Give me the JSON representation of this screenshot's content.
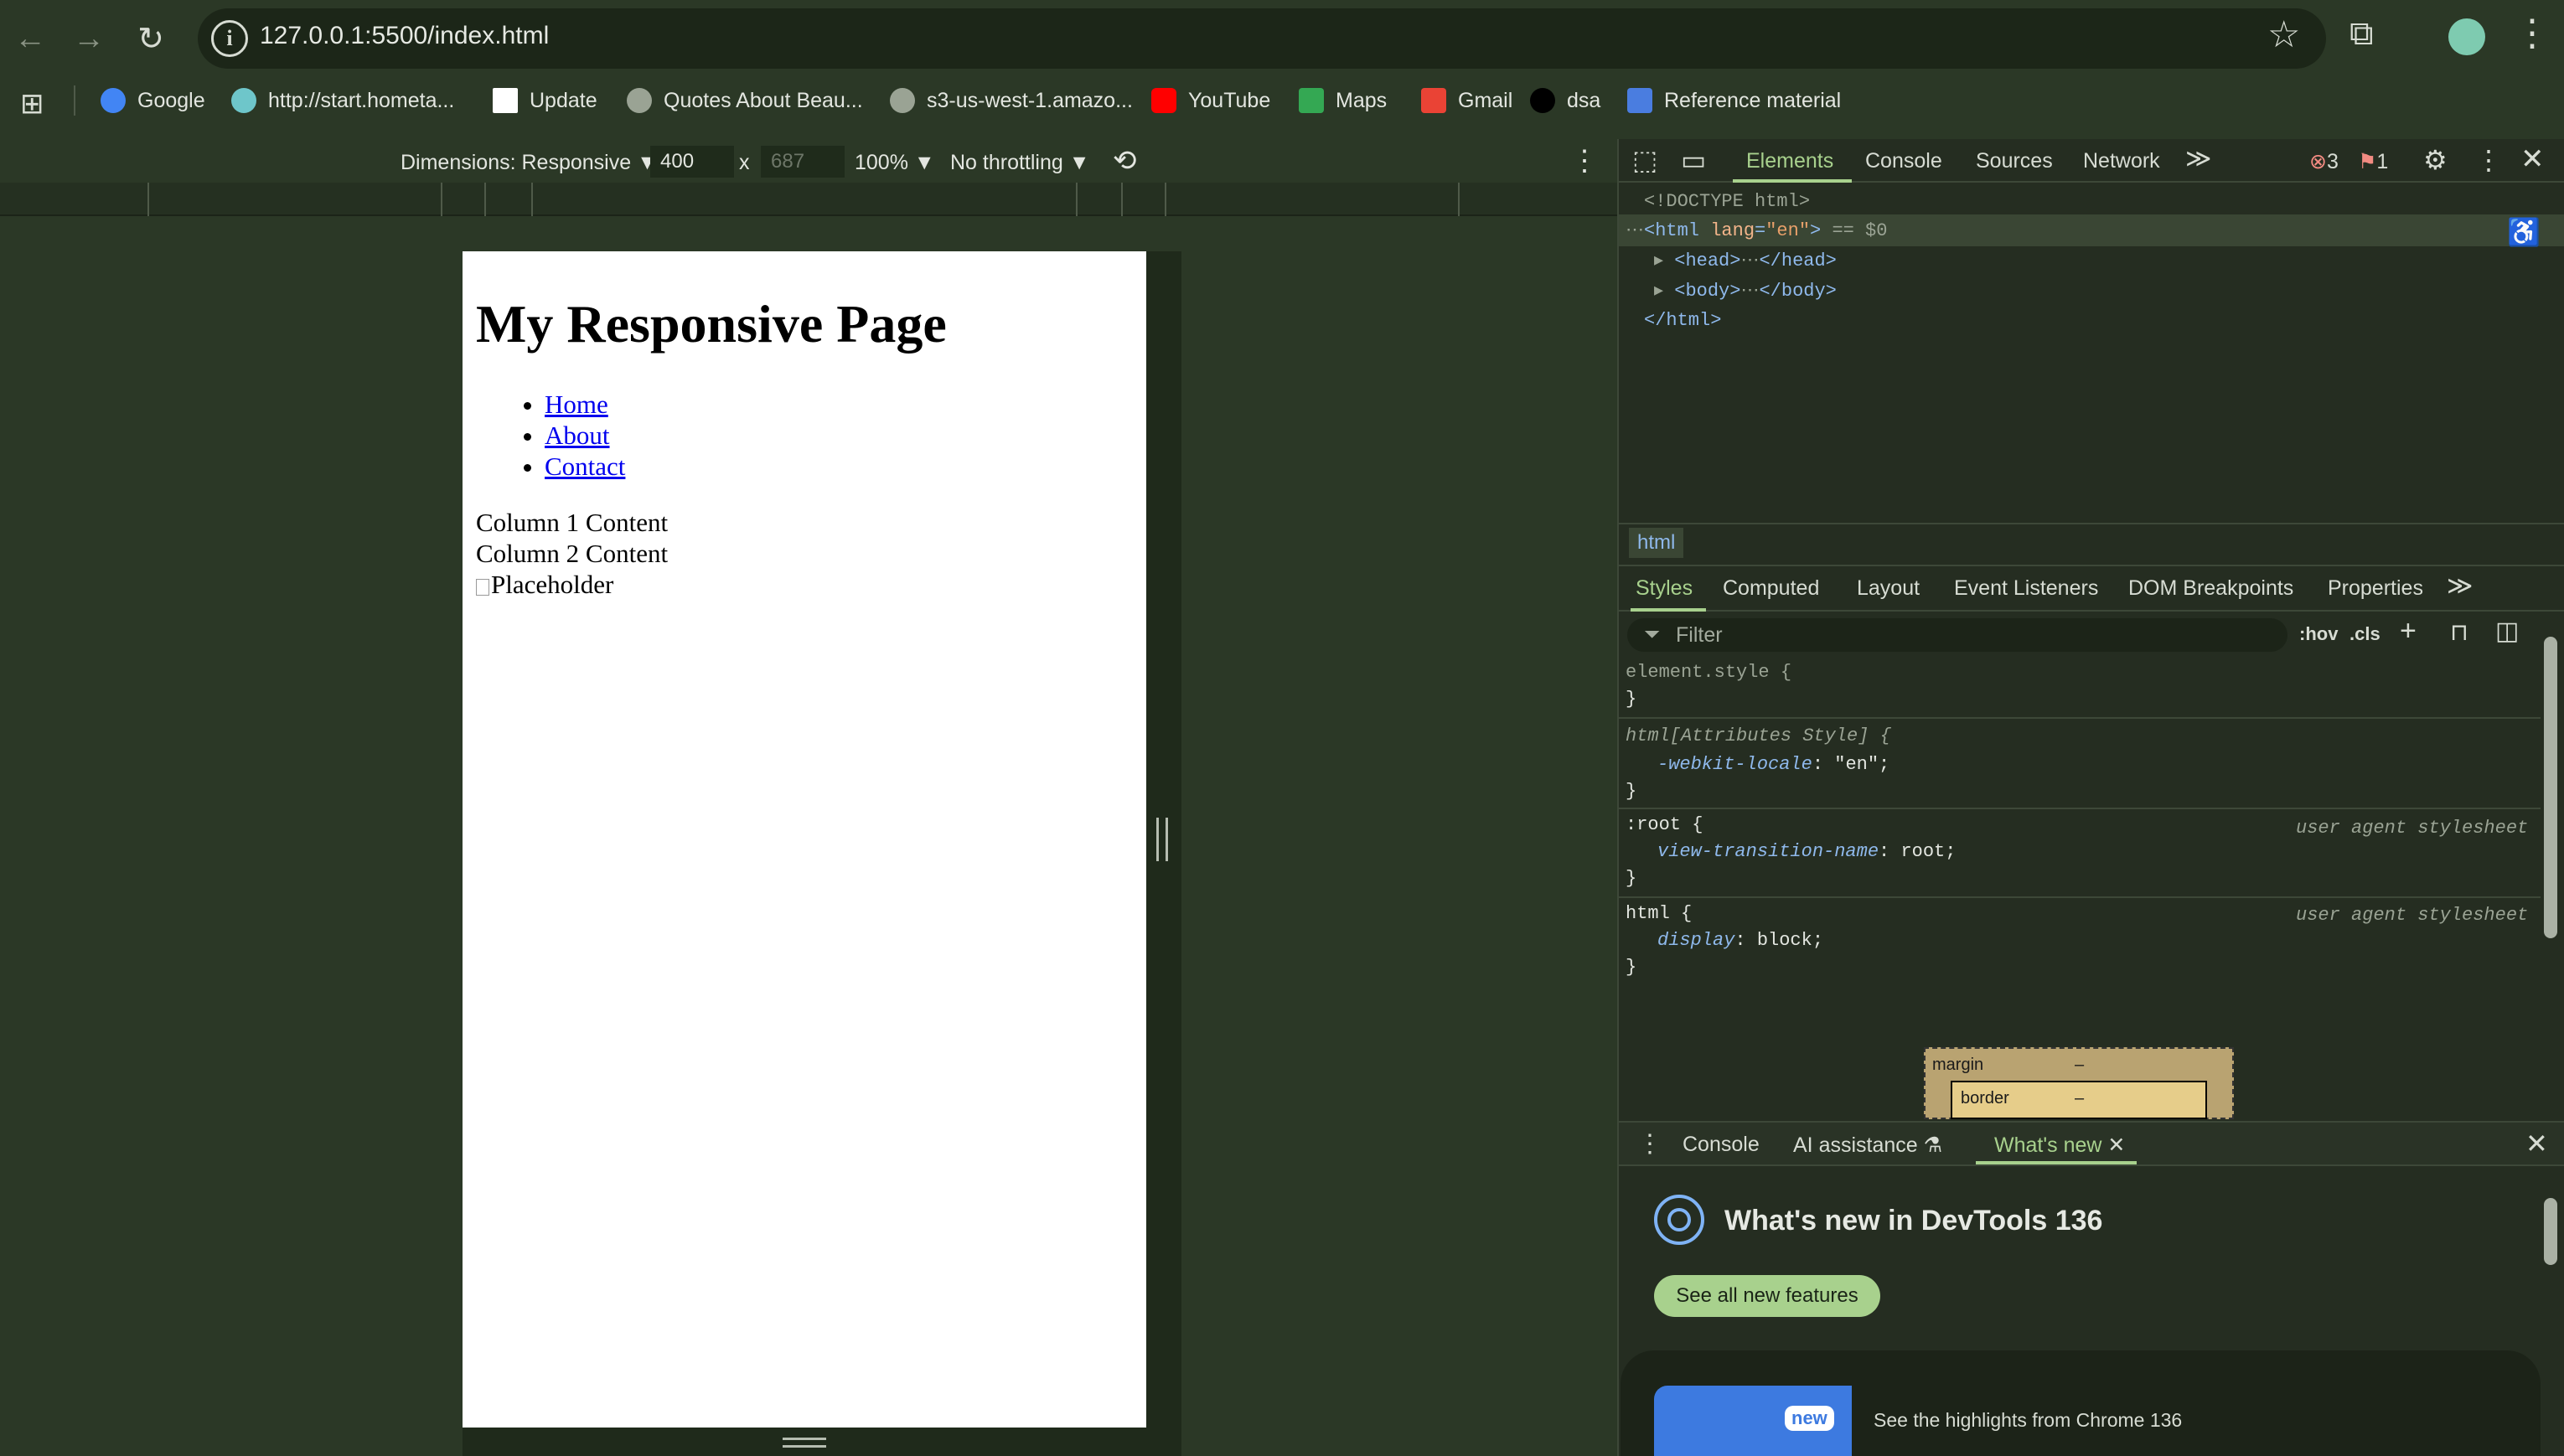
{
  "browser": {
    "url": "127.0.0.1:5500/index.html",
    "bookmarks": [
      "Google",
      "http://start.hometa...",
      "Update",
      "Quotes About Beau...",
      "s3-us-west-1.amazo...",
      "YouTube",
      "Maps",
      "Gmail",
      "dsa",
      "Reference material"
    ]
  },
  "device_toolbar": {
    "dimensions_label": "Dimensions: Responsive ▼",
    "width": "400",
    "times": "x",
    "height": "687",
    "zoom": "100% ▼",
    "throttling": "No throttling ▼"
  },
  "page": {
    "title": "My Responsive Page",
    "nav": [
      "Home",
      "About",
      "Contact"
    ],
    "col1": "Column 1 Content",
    "col2": "Column 2 Content",
    "img_alt": "Placeholder"
  },
  "devtools": {
    "tabs": [
      "Elements",
      "Console",
      "Sources",
      "Network"
    ],
    "more": "≫",
    "errors": "3",
    "warnings": "1",
    "dom": {
      "doctype": "<!DOCTYPE html>",
      "html_open": "<html",
      "lang_attr": "lang",
      "lang_val": "\"en\"",
      "html_close_bracket": ">",
      "eq0": "== $0",
      "head_open": "<head>",
      "head_close": "</head>",
      "body_open": "<body>",
      "body_close": "</body>",
      "html_end": "</html>",
      "ellipsis": "⋯"
    },
    "crumb": "html",
    "style_tabs": [
      "Styles",
      "Computed",
      "Layout",
      "Event Listeners",
      "DOM Breakpoints",
      "Properties"
    ],
    "filter_placeholder": "Filter",
    "hov": ":hov",
    "cls": ".cls",
    "rules": [
      {
        "selector": "element.style {",
        "prop": "",
        "value": "",
        "close": "}",
        "source": ""
      },
      {
        "selector": "html[Attributes Style] {",
        "prop": "-webkit-locale",
        "value": ": \"en\";",
        "close": "}",
        "source": ""
      },
      {
        "selector": ":root {",
        "prop": "view-transition-name",
        "value": ": root;",
        "close": "}",
        "source": "user agent stylesheet"
      },
      {
        "selector": "html {",
        "prop": "display",
        "value": ": block;",
        "close": "}",
        "source": "user agent stylesheet"
      }
    ],
    "box_model": {
      "margin": "margin",
      "border": "border",
      "dash": "–"
    },
    "drawer_tabs": [
      "Console",
      "AI assistance",
      "What's new"
    ],
    "whats_new_title": "What's new in DevTools 136",
    "see_all": "See all new features",
    "card_badge": "new",
    "card_text": "See the highlights from Chrome 136"
  }
}
